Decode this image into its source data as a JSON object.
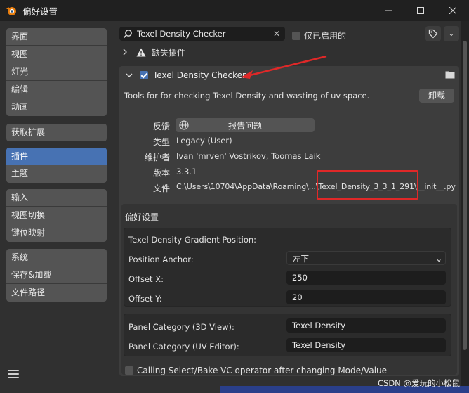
{
  "window": {
    "title": "偏好设置"
  },
  "colors": {
    "accent": "#4772b3",
    "annotation": "#e02828",
    "panel": "#3d3d3d",
    "background": "#303030"
  },
  "sidebar": {
    "groups": [
      {
        "items": [
          {
            "label": "界面"
          },
          {
            "label": "视图"
          },
          {
            "label": "灯光"
          },
          {
            "label": "编辑"
          },
          {
            "label": "动画"
          }
        ]
      },
      {
        "items": [
          {
            "label": "获取扩展"
          }
        ]
      },
      {
        "items": [
          {
            "label": "插件",
            "active": true
          },
          {
            "label": "主题"
          }
        ]
      },
      {
        "items": [
          {
            "label": "输入"
          },
          {
            "label": "视图切换"
          },
          {
            "label": "键位映射"
          }
        ]
      },
      {
        "items": [
          {
            "label": "系统"
          },
          {
            "label": "保存&加载"
          },
          {
            "label": "文件路径"
          }
        ]
      }
    ]
  },
  "toolbar": {
    "search_value": "Texel Density Checker",
    "enabled_only_label": "仅已启用的",
    "enabled_only_checked": false
  },
  "missing_addons": {
    "label": "缺失插件"
  },
  "addon": {
    "name": "Texel Density Checker",
    "enabled": true,
    "description": "Tools for for checking Texel Density and wasting of uv space.",
    "remove_label": "卸载",
    "info": {
      "feedback_label": "反馈",
      "report_label": "报告问题",
      "type_label": "类型",
      "type_value": "Legacy (User)",
      "maintainer_label": "维护者",
      "maintainer_value": "Ivan 'mrven' Vostrikov, Toomas Laik",
      "version_label": "版本",
      "version_value": "3.3.1",
      "file_label": "文件",
      "file_value": "C:\\Users\\10704\\AppData\\Roaming\\...\\Texel_Density_3_3_1_291\\__init__.py"
    },
    "preferences": {
      "title": "偏好设置",
      "gradient_title": "Texel Density Gradient Position:",
      "position_anchor_label": "Position Anchor:",
      "position_anchor_value": "左下",
      "offset_x_label": "Offset X:",
      "offset_x_value": "250",
      "offset_y_label": "Offset Y:",
      "offset_y_value": "20",
      "panel_3d_label": "Panel Category (3D View):",
      "panel_3d_value": "Texel Density",
      "panel_uv_label": "Panel Category (UV Editor):",
      "panel_uv_value": "Texel Density",
      "calling_label": "Calling Select/Bake VC operator after changing Mode/Value",
      "calling_checked": false
    }
  },
  "watermark": "CSDN @爱玩的小松鼠"
}
